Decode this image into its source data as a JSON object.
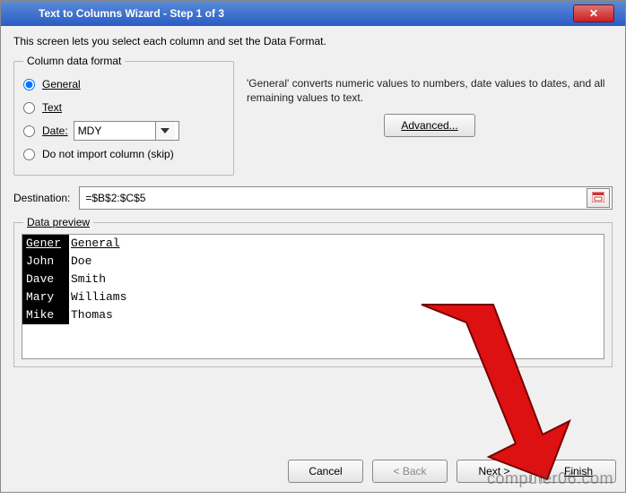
{
  "title": "Text to Columns Wizard - Step 1 of 3",
  "instruction": "This screen lets you select each column and set the Data Format.",
  "format_group": {
    "legend": "Column data format",
    "general": "General",
    "text": "Text",
    "date": "Date:",
    "date_value": "MDY",
    "skip": "Do not import column (skip)"
  },
  "note": "'General' converts numeric values to numbers, date values to dates, and all remaining values to text.",
  "advanced": "Advanced...",
  "destination_label": "Destination:",
  "destination_value": "=$B$2:$C$5",
  "preview_label": "Data preview",
  "preview": {
    "header": {
      "c1": "Gener",
      "c2": "General"
    },
    "rows": [
      {
        "c1": "John",
        "c2": "Doe"
      },
      {
        "c1": "Dave",
        "c2": "Smith"
      },
      {
        "c1": "Mary",
        "c2": "Williams"
      },
      {
        "c1": "Mike",
        "c2": "Thomas"
      }
    ]
  },
  "buttons": {
    "cancel": "Cancel",
    "back": "< Back",
    "next": "Next >",
    "finish": "Finish"
  },
  "watermark": "computer06.com"
}
